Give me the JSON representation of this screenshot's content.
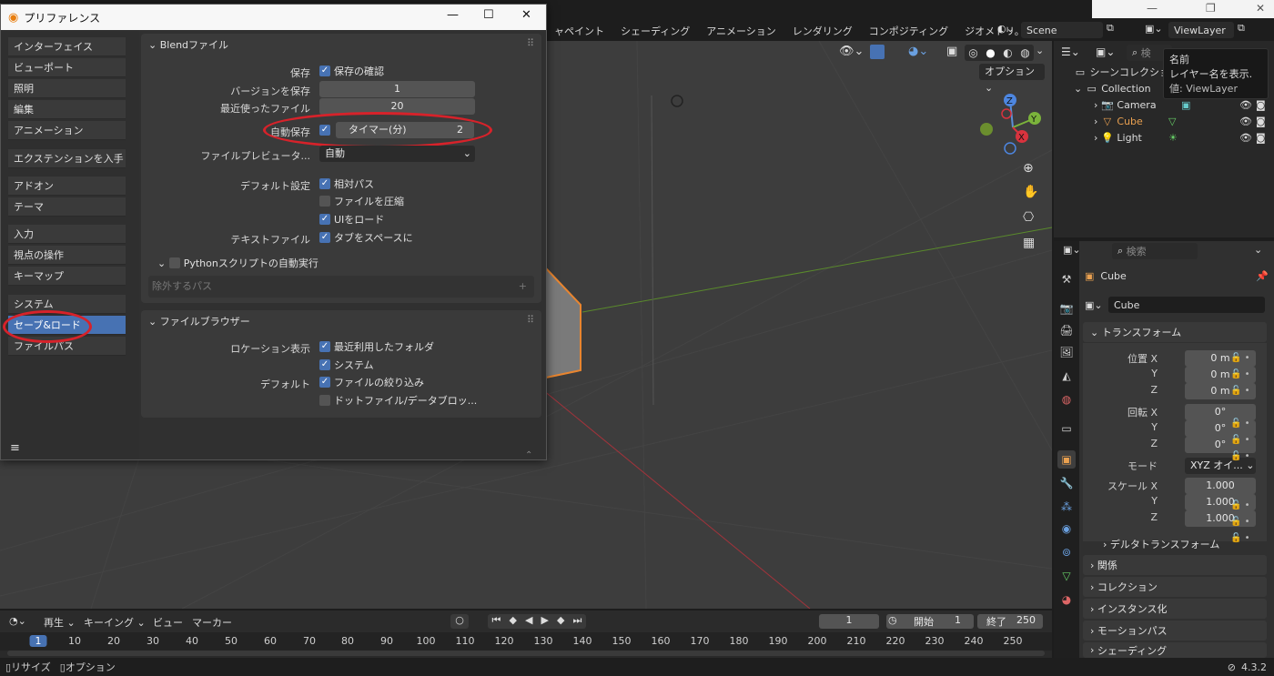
{
  "window": {
    "title": "プリファレンス"
  },
  "topbar": {
    "tabs": [
      "ャペイント",
      "シェーディング",
      "アニメーション",
      "レンダリング",
      "コンポジティング",
      "ジオメトリ。"
    ],
    "scene": "Scene",
    "view_layer": "ViewLayer"
  },
  "tooltip": {
    "line1": "名前",
    "line2": "レイヤー名を表示.",
    "line3": "値: ViewLayer"
  },
  "prefs": {
    "nav": [
      [
        "インターフェイス",
        "ビューポート",
        "照明",
        "編集",
        "アニメーション"
      ],
      [
        "エクステンションを入手"
      ],
      [
        "アドオン",
        "テーマ"
      ],
      [
        "入力",
        "視点の操作",
        "キーマップ"
      ],
      [
        "システム",
        "セーブ&ロード",
        "ファイルパス"
      ]
    ],
    "blend": {
      "header": "Blendファイル",
      "save_label": "保存",
      "save_confirm": "保存の確認",
      "versions_label": "バージョンを保存",
      "versions_value": "1",
      "recent_label": "最近使ったファイル",
      "recent_value": "20",
      "autosave_label": "自動保存",
      "timer_label": "タイマー(分)",
      "timer_value": "2",
      "preview_label": "ファイルプレビュータ...",
      "preview_value": "自動",
      "default_label": "デフォルト設定",
      "relative_paths": "相対パス",
      "compress": "ファイルを圧縮",
      "load_ui": "UIをロード",
      "text_label": "テキストファイル",
      "tabs_spaces": "タブをスペースに",
      "python_autorun": "Pythonスクリプトの自動実行",
      "exclude_paths": "除外するパス"
    },
    "browser": {
      "header": "ファイルブラウザー",
      "location_label": "ロケーション表示",
      "recent_folders": "最近利用したフォルダ",
      "system": "システム",
      "default_label": "デフォルト",
      "filter_files": "ファイルの絞り込み",
      "dot_files": "ドットファイル/データブロッ..."
    }
  },
  "viewport": {
    "options_label": "オプション"
  },
  "outliner": {
    "search_placeholder": "検",
    "scene_collection": "シーンコレクショ",
    "collection": "Collection",
    "items": [
      "Camera",
      "Cube",
      "Light"
    ]
  },
  "properties": {
    "search_placeholder": "検索",
    "object_name": "Cube",
    "object_field": "Cube",
    "transform_header": "トランスフォーム",
    "location_label": "位置 X",
    "location": [
      "0 m",
      "0 m",
      "0 m"
    ],
    "rotation_label": "回転 X",
    "rotation": [
      "0°",
      "0°",
      "0°"
    ],
    "mode_label": "モード",
    "mode_value": "XYZ オイ...",
    "scale_label": "スケール X",
    "scale": [
      "1.000",
      "1.000",
      "1.000"
    ],
    "axis_y": "Y",
    "axis_z": "Z",
    "delta_transform": "デルタトランスフォーム",
    "sections": [
      "関係",
      "コレクション",
      "インスタンス化",
      "モーションパス",
      "シェーディング"
    ]
  },
  "timeline": {
    "menus": [
      "再生",
      "キーイング",
      "ビュー",
      "マーカー"
    ],
    "current_frame": "1",
    "start_label": "開始",
    "start_value": "1",
    "end_label": "終了",
    "end_value": "250",
    "ticks": [
      "1",
      "10",
      "20",
      "30",
      "40",
      "50",
      "60",
      "70",
      "80",
      "90",
      "100",
      "110",
      "120",
      "130",
      "140",
      "150",
      "160",
      "170",
      "180",
      "190",
      "200",
      "210",
      "220",
      "230",
      "240",
      "250"
    ]
  },
  "statusbar": {
    "resize": "リサイズ",
    "options": "オプション",
    "version": "4.3.2"
  }
}
